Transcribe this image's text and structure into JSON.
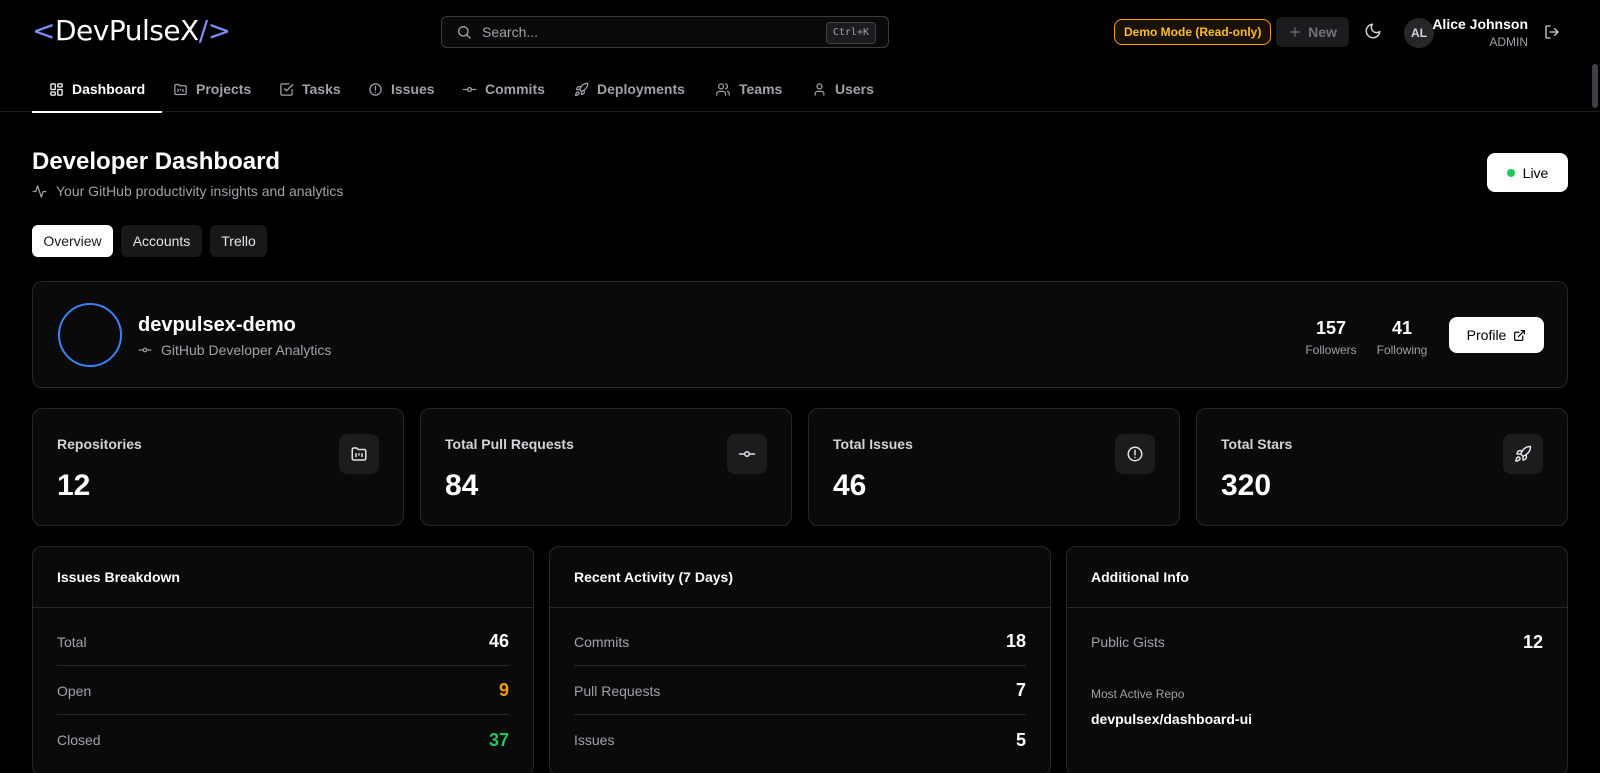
{
  "header": {
    "logo_open": "<",
    "logo_name": "DevPulseX",
    "logo_close": "/>",
    "search_placeholder": "Search...",
    "search_shortcut": "Ctrl+K",
    "demo_badge": "Demo Mode (Read-only)",
    "new_button": "New",
    "user": {
      "initials": "AL",
      "name": "Alice Johnson",
      "role": "ADMIN"
    }
  },
  "nav": {
    "items": [
      {
        "label": "Dashboard",
        "icon": "dashboard-icon"
      },
      {
        "label": "Projects",
        "icon": "folder-kanban-icon"
      },
      {
        "label": "Tasks",
        "icon": "check-square-icon"
      },
      {
        "label": "Issues",
        "icon": "alert-circle-icon"
      },
      {
        "label": "Commits",
        "icon": "git-commit-icon"
      },
      {
        "label": "Deployments",
        "icon": "rocket-icon"
      },
      {
        "label": "Teams",
        "icon": "users-icon"
      },
      {
        "label": "Users",
        "icon": "user-icon"
      }
    ],
    "active": "Dashboard"
  },
  "page": {
    "title": "Developer Dashboard",
    "subtitle": "Your GitHub productivity insights and analytics",
    "live_label": "Live",
    "tabs": [
      "Overview",
      "Accounts",
      "Trello"
    ],
    "active_tab": "Overview"
  },
  "profile": {
    "username": "devpulsex-demo",
    "subtitle": "GitHub Developer Analytics",
    "followers": "157",
    "followers_label": "Followers",
    "following": "41",
    "following_label": "Following",
    "profile_button": "Profile"
  },
  "metrics": [
    {
      "label": "Repositories",
      "value": "12",
      "icon": "folder-kanban-icon"
    },
    {
      "label": "Total Pull Requests",
      "value": "84",
      "icon": "git-commit-icon"
    },
    {
      "label": "Total Issues",
      "value": "46",
      "icon": "alert-circle-icon"
    },
    {
      "label": "Total Stars",
      "value": "320",
      "icon": "rocket-icon"
    }
  ],
  "issues_breakdown": {
    "title": "Issues Breakdown",
    "rows": [
      {
        "label": "Total",
        "value": "46",
        "color": "#ffffff"
      },
      {
        "label": "Open",
        "value": "9",
        "color": "#f59e0b"
      },
      {
        "label": "Closed",
        "value": "37",
        "color": "#22c55e"
      }
    ]
  },
  "recent_activity": {
    "title": "Recent Activity (7 Days)",
    "rows": [
      {
        "label": "Commits",
        "value": "18"
      },
      {
        "label": "Pull Requests",
        "value": "7"
      },
      {
        "label": "Issues",
        "value": "5"
      }
    ]
  },
  "additional_info": {
    "title": "Additional Info",
    "public_gists_label": "Public Gists",
    "public_gists_value": "12",
    "most_active_repo_label": "Most Active Repo",
    "most_active_repo_value": "devpulsex/dashboard-ui"
  },
  "colors": {
    "accent": "#818cf8",
    "live": "#22c55e",
    "open": "#f59e0b",
    "closed": "#22c55e",
    "avatar_ring": "#3b82f6"
  }
}
